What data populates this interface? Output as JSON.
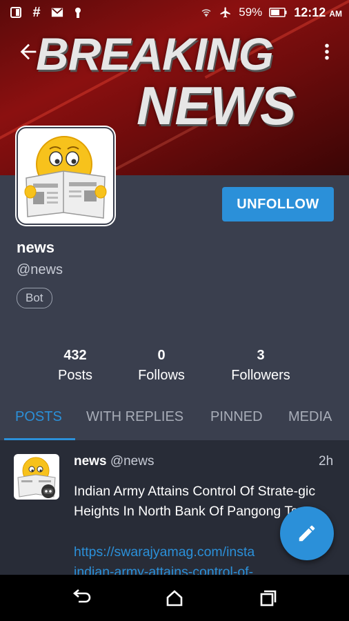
{
  "status_bar": {
    "battery": "59%",
    "time": "12:12",
    "ampm": "AM",
    "icons": [
      "sim-card-icon",
      "hashtag-icon",
      "gmail-icon",
      "keyhole-icon",
      "wifi-icon",
      "airplane-icon",
      "battery-icon"
    ]
  },
  "header": {
    "banner_line1": "BREAKING",
    "banner_line2": "NEWS",
    "back_icon": "arrow-left-icon",
    "menu_icon": "more-vert-icon"
  },
  "profile": {
    "display_name": "news",
    "handle": "@news",
    "badge": "Bot",
    "unfollow_label": "UNFOLLOW"
  },
  "stats": {
    "posts": {
      "value": "432",
      "label": "Posts"
    },
    "follows": {
      "value": "0",
      "label": "Follows"
    },
    "followers": {
      "value": "3",
      "label": "Followers"
    }
  },
  "tabs": [
    {
      "label": "POSTS",
      "active": true
    },
    {
      "label": "WITH REPLIES",
      "active": false
    },
    {
      "label": "PINNED",
      "active": false
    },
    {
      "label": "MEDIA",
      "active": false
    }
  ],
  "post": {
    "name": "news",
    "handle": "@news",
    "time": "2h",
    "text": "Indian Army Attains Control Of Strate-gic Heights In North Bank Of Pangong Tso",
    "link_line1": "https://swarajyamag.com/insta",
    "link_line2": "indian-army-attains-control-of-"
  },
  "colors": {
    "accent": "#2b90d9",
    "background": "#3a3f4e",
    "feed_background": "#282c37",
    "banner_red": "#8b1010"
  },
  "fab": {
    "icon": "pencil-icon"
  },
  "nav": {
    "icons": [
      "back-nav-icon",
      "home-nav-icon",
      "recents-nav-icon"
    ]
  }
}
